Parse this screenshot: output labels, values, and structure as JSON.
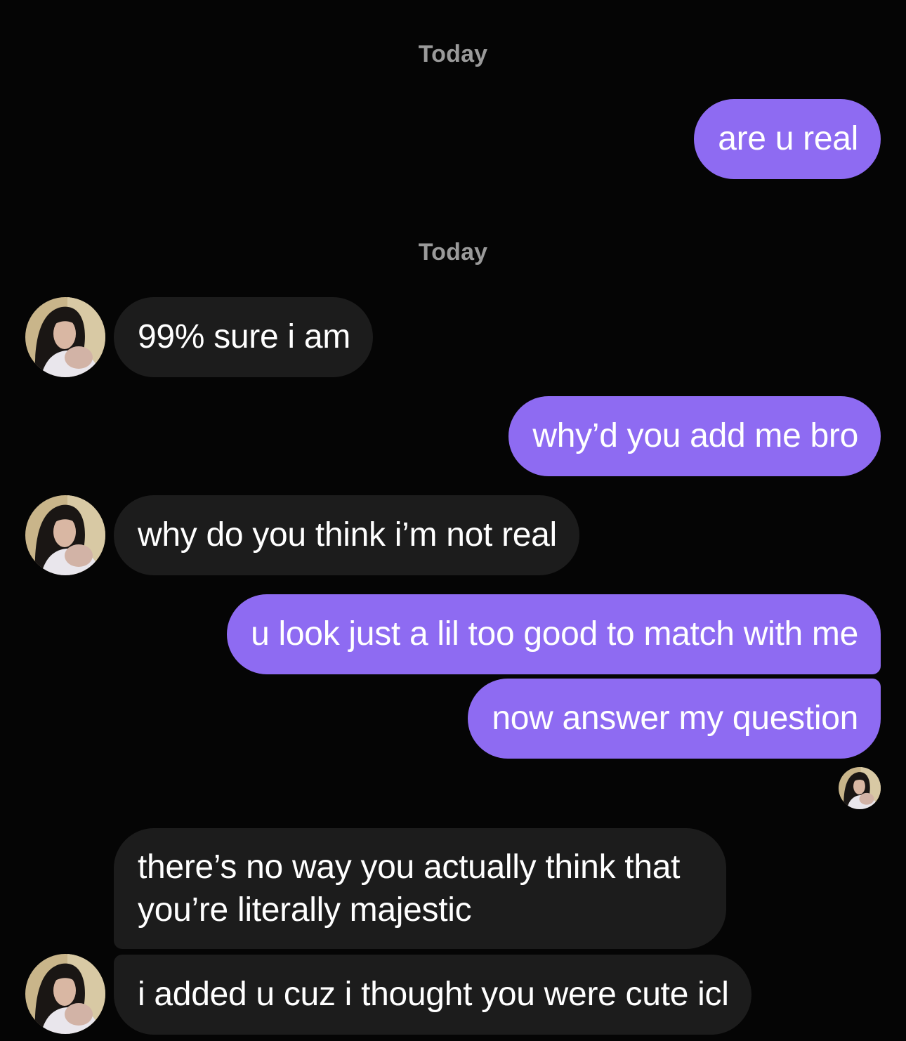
{
  "conversation": {
    "day_label_1": "Today",
    "day_label_2": "Today",
    "messages": [
      {
        "sender": "me",
        "text": "are u real"
      },
      {
        "sender": "them",
        "text": "99% sure i am"
      },
      {
        "sender": "me",
        "text": "why’d you add me bro"
      },
      {
        "sender": "them",
        "text": "why do you think i’m not real"
      },
      {
        "sender": "me",
        "text": "u look just a lil too good to match with me"
      },
      {
        "sender": "me",
        "text": "now answer my question"
      },
      {
        "sender": "them",
        "text": "there’s no way you actually think that you’re literally majestic"
      },
      {
        "sender": "them",
        "text": "i added u cuz i thought you were cute icl"
      }
    ]
  },
  "colors": {
    "background": "#050505",
    "sent_bubble": "#8e6bf2",
    "received_bubble": "#1c1c1c",
    "day_label": "#9a9a9a"
  },
  "icons": {
    "avatar": "profile-photo-avatar"
  }
}
